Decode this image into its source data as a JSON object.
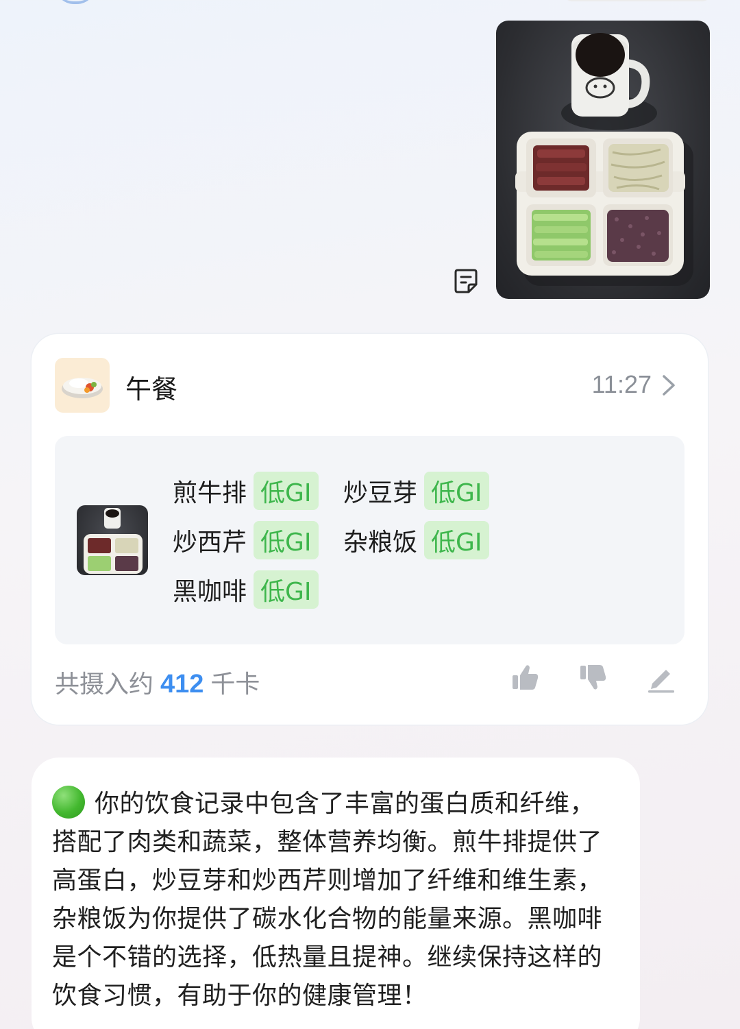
{
  "meal_card": {
    "title": "午餐",
    "time": "11:27",
    "foods": [
      {
        "name": "煎牛排",
        "tag": "低GI"
      },
      {
        "name": "炒豆芽",
        "tag": "低GI"
      },
      {
        "name": "炒西芹",
        "tag": "低GI"
      },
      {
        "name": "杂粮饭",
        "tag": "低GI"
      },
      {
        "name": "黑咖啡",
        "tag": "低GI"
      }
    ],
    "intake_prefix": "共摄入约",
    "intake_value": "412",
    "intake_unit": "千卡",
    "icons": {
      "meal": "rice-bowl-icon",
      "chevron": "chevron-right-icon",
      "like": "thumbs-up-icon",
      "dislike": "thumbs-down-icon",
      "edit": "pencil-icon"
    }
  },
  "reply": {
    "text": "你的饮食记录中包含了丰富的蛋白质和纤维，搭配了肉类和蔬菜，整体营养均衡。煎牛排提供了高蛋白，炒豆芽和炒西芹则增加了纤维和维生素，杂粮饭为你提供了碳水化合物的能量来源。黑咖啡是个不错的选择，低热量且提神。继续保持这样的饮食习惯，有助于你的健康管理！"
  },
  "colors": {
    "gi_tag_bg": "#d6f2d1",
    "gi_tag_text": "#3eb64c",
    "accent_number": "#3d8ef0",
    "muted_text": "#8d9097"
  }
}
